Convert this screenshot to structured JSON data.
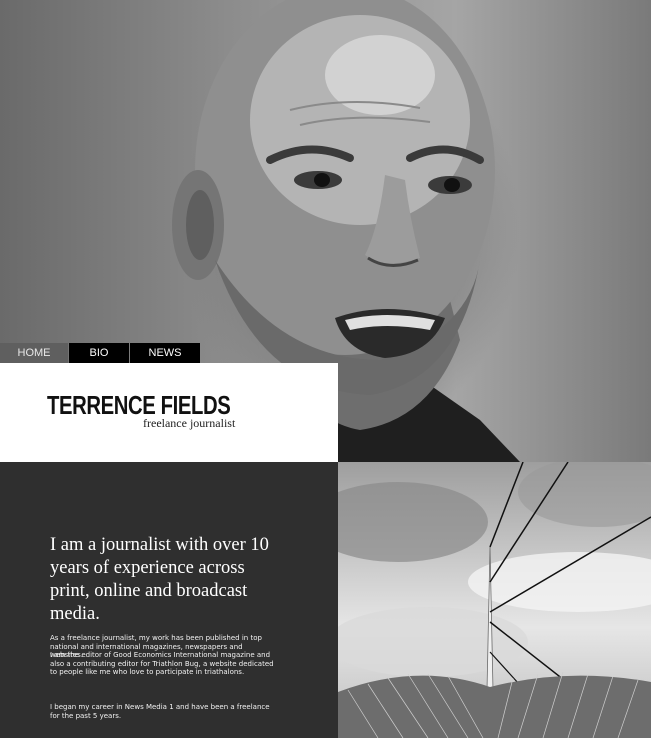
{
  "nav": {
    "home": "HOME",
    "bio": "BIO",
    "news": "NEWS"
  },
  "profile": {
    "name": "TERRENCE FIELDS",
    "role": "freelance journalist"
  },
  "intro": {
    "headline": "I am a journalist with over 10 years of experience across print, online and broadcast media.",
    "paragraph1": "As a freelance journalist, my work has been published in top national and international magazines, newspapers and websites.",
    "paragraph2": "I am the editor of Good Economics International magazine and also a contributing editor for Triathlon Bug, a website dedicated to people like me who love to participate in triathalons.",
    "paragraph3": "I began my career in News Media 1 and have been a freelance for the past 5 years."
  }
}
